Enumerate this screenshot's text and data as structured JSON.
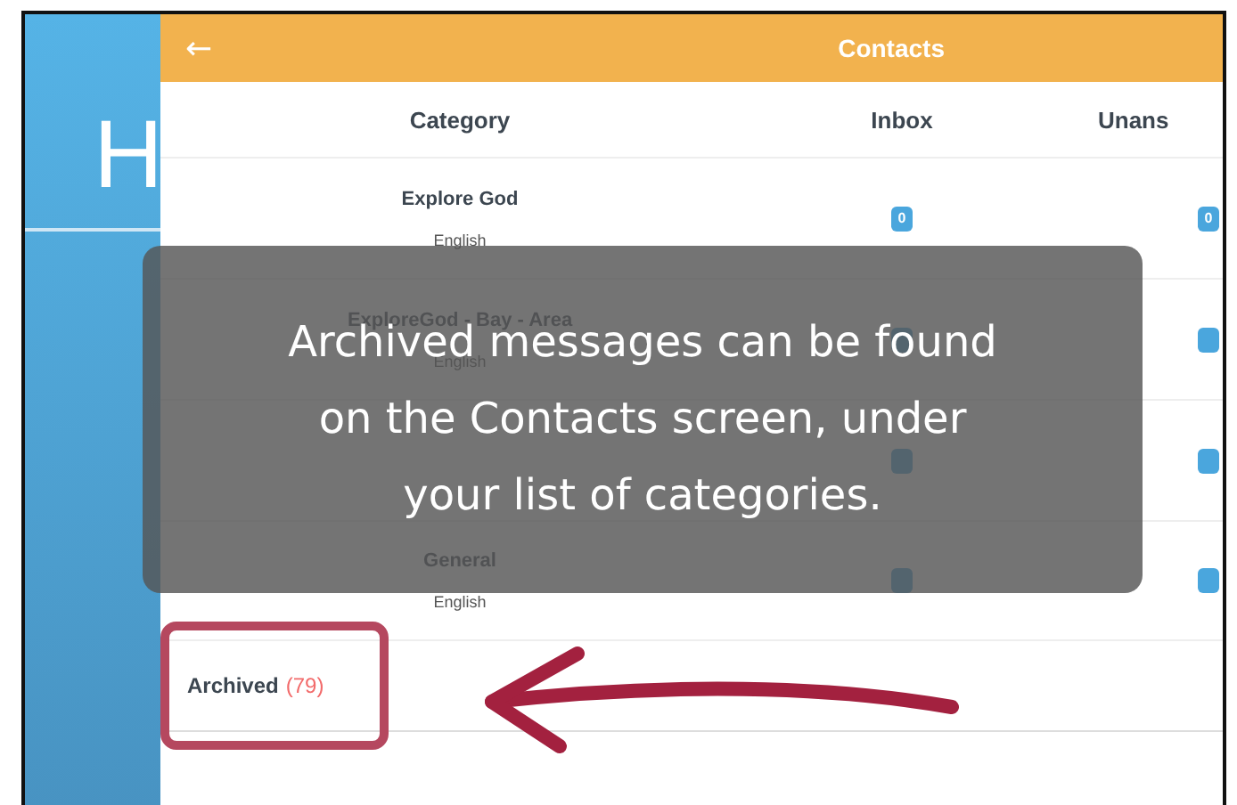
{
  "sidebar": {
    "logo_letter": "H"
  },
  "header": {
    "back_icon": "←",
    "title": "Contacts"
  },
  "table": {
    "columns": [
      "Category",
      "Inbox",
      "Unans"
    ],
    "rows": [
      {
        "name": "Explore God",
        "language": "English",
        "inbox": "0",
        "unanswered": "0"
      },
      {
        "name": "ExploreGod - Bay - Area",
        "language": "English"
      },
      {},
      {
        "name": "General",
        "language": "English"
      }
    ]
  },
  "archived": {
    "label": "Archived",
    "count": "(79)"
  },
  "tooltip": {
    "text": "Archived messages can be found on the Contacts screen, under your list of categories."
  }
}
